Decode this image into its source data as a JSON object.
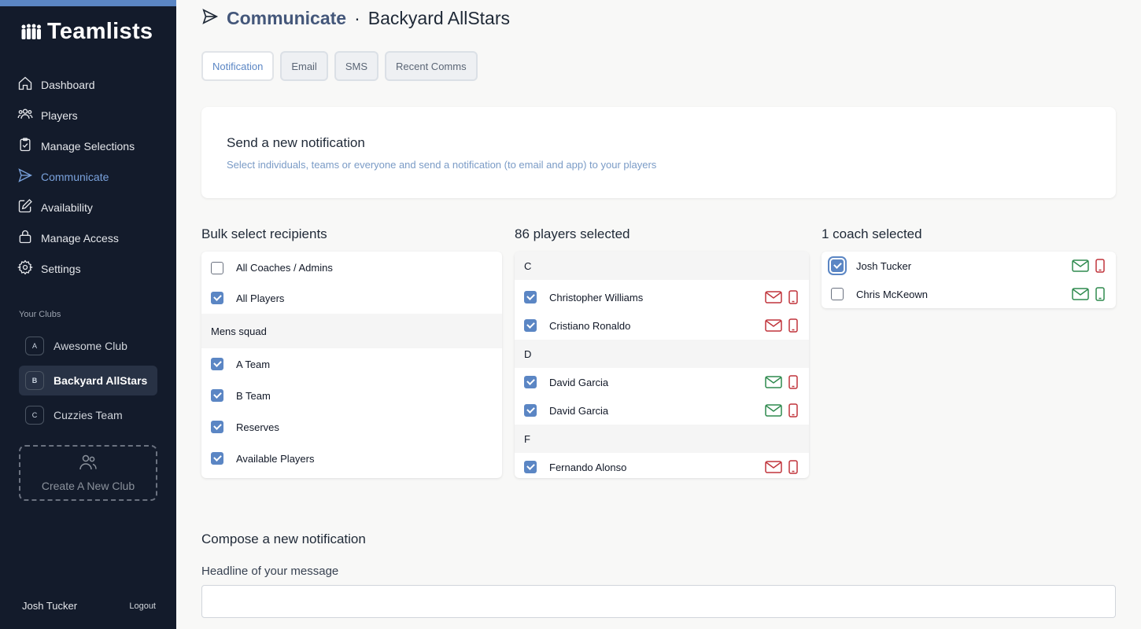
{
  "app": {
    "name": "Teamlists"
  },
  "sidebar": {
    "nav": [
      {
        "label": "Dashboard",
        "icon": "home-icon"
      },
      {
        "label": "Players",
        "icon": "users-icon"
      },
      {
        "label": "Manage Selections",
        "icon": "clipboard-check-icon"
      },
      {
        "label": "Communicate",
        "icon": "send-icon",
        "active": true
      },
      {
        "label": "Availability",
        "icon": "edit-icon"
      },
      {
        "label": "Manage Access",
        "icon": "lock-icon"
      },
      {
        "label": "Settings",
        "icon": "gear-icon"
      }
    ],
    "clubs_label": "Your Clubs",
    "clubs": [
      {
        "badge": "A",
        "name": "Awesome Club"
      },
      {
        "badge": "B",
        "name": "Backyard AllStars",
        "active": true
      },
      {
        "badge": "C",
        "name": "Cuzzies Team"
      }
    ],
    "create_club_label": "Create A New Club",
    "user_name": "Josh Tucker",
    "logout_label": "Logout"
  },
  "header": {
    "page_title": "Communicate",
    "separator": "·",
    "club_name": "Backyard AllStars"
  },
  "tabs": [
    {
      "label": "Notification",
      "active": true
    },
    {
      "label": "Email"
    },
    {
      "label": "SMS"
    },
    {
      "label": "Recent Comms"
    }
  ],
  "intro": {
    "title": "Send a new notification",
    "subtitle": "Select individuals, teams or everyone and send a notification (to email and app) to your players"
  },
  "bulk": {
    "title": "Bulk select recipients",
    "rows": [
      {
        "label": "All Coaches / Admins",
        "checked": false
      },
      {
        "label": "All Players",
        "checked": true
      }
    ],
    "group_label": "Mens squad",
    "group_rows": [
      {
        "label": "A Team",
        "checked": true
      },
      {
        "label": "B Team",
        "checked": true
      },
      {
        "label": "Reserves",
        "checked": true
      },
      {
        "label": "Available Players",
        "checked": true
      }
    ]
  },
  "players": {
    "title": "86 players selected",
    "sections": [
      {
        "letter": "C",
        "items": [
          {
            "name": "Christopher Williams",
            "checked": true,
            "email_ok": false,
            "phone_ok": false
          },
          {
            "name": "Cristiano Ronaldo",
            "checked": true,
            "email_ok": false,
            "phone_ok": false
          }
        ]
      },
      {
        "letter": "D",
        "items": [
          {
            "name": "David Garcia",
            "checked": true,
            "email_ok": true,
            "phone_ok": false
          },
          {
            "name": "David Garcia",
            "checked": true,
            "email_ok": true,
            "phone_ok": false
          }
        ]
      },
      {
        "letter": "F",
        "items": [
          {
            "name": "Fernando Alonso",
            "checked": true,
            "email_ok": false,
            "phone_ok": false
          }
        ]
      }
    ]
  },
  "coaches": {
    "title": "1 coach selected",
    "items": [
      {
        "name": "Josh Tucker",
        "checked": true,
        "email_ok": true,
        "phone_ok": false
      },
      {
        "name": "Chris McKeown",
        "checked": false,
        "email_ok": true,
        "phone_ok": true
      }
    ]
  },
  "compose": {
    "title": "Compose a new notification",
    "headline_label": "Headline of your message",
    "headline_value": ""
  },
  "colors": {
    "accent": "#5b86c4",
    "sidebar_bg": "#131b2b",
    "ok_green": "#2f8a4e",
    "bad_red": "#c0343b"
  }
}
